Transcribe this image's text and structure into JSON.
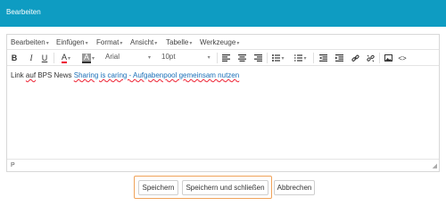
{
  "dialog": {
    "title": "Bearbeiten",
    "header_color": "#0e9cc2"
  },
  "menubar": {
    "items": [
      "Bearbeiten",
      "Einfügen",
      "Format",
      "Ansicht",
      "Tabelle",
      "Werkzeuge"
    ]
  },
  "toolbar": {
    "bold": "B",
    "italic": "I",
    "underline": "U",
    "font_color_label": "A",
    "background_color_label": "A",
    "font_family": "Arial",
    "font_size": "10pt"
  },
  "content": {
    "prefix_word1": "Link",
    "prefix_word2": "auf",
    "prefix_word3": "BPS News",
    "link_text": "Sharing is caring - Aufgabenpool gemeinsam nutzen"
  },
  "statusbar": {
    "path": "P"
  },
  "buttons": {
    "save": "Speichern",
    "save_close": "Speichern und schließen",
    "cancel": "Abbrechen"
  },
  "colors": {
    "highlight": "#f0a35a",
    "link": "#1a6fb8"
  }
}
